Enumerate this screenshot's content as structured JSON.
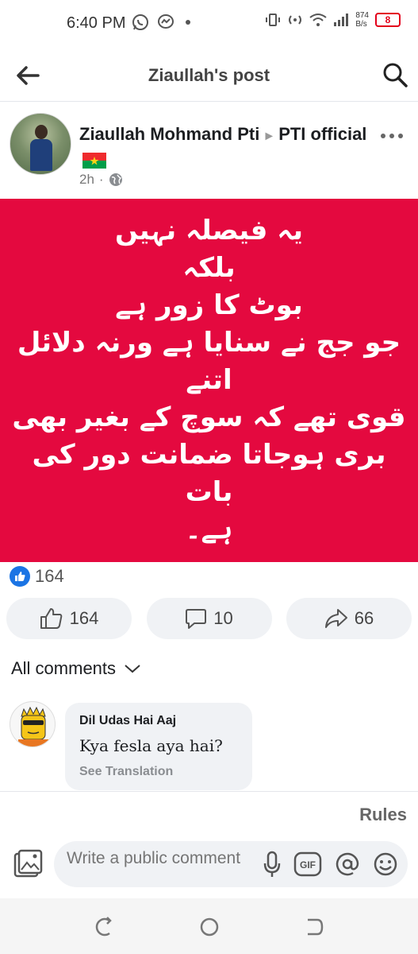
{
  "status_bar": {
    "time": "6:40 PM",
    "net_speed_value": "874",
    "net_speed_unit": "B/s",
    "battery_level": "8",
    "icons": [
      "whatsapp-icon",
      "messenger-icon",
      "dot-icon",
      "vibrate-icon",
      "hotspot-icon",
      "wifi-icon",
      "signal-icon",
      "battery-icon"
    ]
  },
  "appbar": {
    "title": "Ziaullah's post"
  },
  "post": {
    "author": "Ziaullah Mohmand Pti",
    "group": "PTI official",
    "time": "2h",
    "text_lines": [
      "یہ فیصلہ نہیں",
      "بلکہ",
      "بوٹ کا زور ہے",
      "جو جج نے سنایا ہے ورنہ دلائل اتنے",
      "قوی تھے کہ سوچ کے بغیر بھی",
      "بری ہوجاتا ضمانت دور کی بات",
      "ہے۔"
    ],
    "background_color": "#e4093f"
  },
  "reactions": {
    "summary_count": "164"
  },
  "actions": {
    "like_count": "164",
    "comment_count": "10",
    "share_count": "66"
  },
  "comments": {
    "filter_label": "All comments",
    "items": [
      {
        "author": "Dil Udas Hai Aaj",
        "text": "Kya fesla aya hai?",
        "translation_label": "See Translation"
      }
    ]
  },
  "rules_label": "Rules",
  "composer": {
    "placeholder": "Write a public comment"
  },
  "colors": {
    "accent_blue": "#1b74e4",
    "post_red": "#e4093f"
  }
}
